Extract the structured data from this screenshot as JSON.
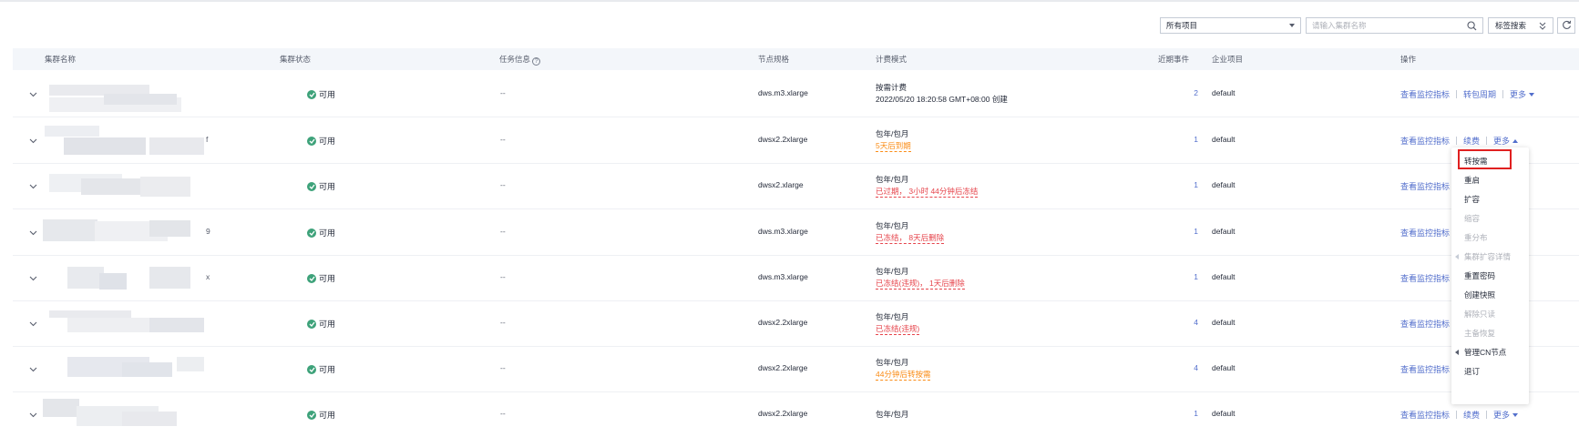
{
  "toolbar": {
    "project_select": "所有项目",
    "search_placeholder": "请输入集群名称",
    "tag_search_label": "标签搜索"
  },
  "table": {
    "headers": {
      "name": "集群名称",
      "status": "集群状态",
      "task": "任务信息",
      "spec": "节点规格",
      "billing": "计费模式",
      "events": "近期事件",
      "project": "企业项目",
      "ops": "操作"
    },
    "rows": [
      {
        "name_suffix": "",
        "status": "可用",
        "task": "--",
        "spec": "dws.m3.xlarge",
        "billing": "按需计费",
        "billing_sub": "2022/05/20 18:20:58 GMT+08:00 创建",
        "billing_sub_style": "plain",
        "events": "2",
        "project": "default",
        "op1": "查看监控指标",
        "op2": "转包周期",
        "more": "更多",
        "more_open": false
      },
      {
        "name_suffix": "f",
        "status": "可用",
        "task": "--",
        "spec": "dwsx2.2xlarge",
        "billing": "包年/包月",
        "billing_sub": "5天后到期",
        "billing_sub_style": "orange",
        "events": "1",
        "project": "default",
        "op1": "查看监控指标",
        "op2": "续费",
        "more": "更多",
        "more_open": true
      },
      {
        "name_suffix": "",
        "status": "可用",
        "task": "--",
        "spec": "dwsx2.xlarge",
        "billing": "包年/包月",
        "billing_sub": "已过期， 3小时 44分钟后冻结",
        "billing_sub_style": "red",
        "events": "1",
        "project": "default",
        "op1": "查看监控指标",
        "op2": "",
        "more": "",
        "more_open": false
      },
      {
        "name_suffix": "9",
        "status": "可用",
        "task": "--",
        "spec": "dws.m3.xlarge",
        "billing": "包年/包月",
        "billing_sub": "已冻结， 8天后删除",
        "billing_sub_style": "red",
        "events": "1",
        "project": "default",
        "op1": "查看监控指标",
        "op2": "",
        "more": "",
        "more_open": false
      },
      {
        "name_suffix": "x",
        "status": "可用",
        "task": "--",
        "spec": "dws.m3.xlarge",
        "billing": "包年/包月",
        "billing_sub": "已冻结(违规)， 1天后删除",
        "billing_sub_style": "red",
        "events": "1",
        "project": "default",
        "op1": "查看监控指标",
        "op2": "",
        "more": "",
        "more_open": false
      },
      {
        "name_suffix": "",
        "status": "可用",
        "task": "--",
        "spec": "dwsx2.2xlarge",
        "billing": "包年/包月",
        "billing_sub": "已冻结(违规)",
        "billing_sub_style": "red",
        "events": "4",
        "project": "default",
        "op1": "查看监控指标",
        "op2": "",
        "more": "",
        "more_open": false
      },
      {
        "name_suffix": "",
        "status": "可用",
        "task": "--",
        "spec": "dwsx2.2xlarge",
        "billing": "包年/包月",
        "billing_sub": "44分钟后转按需",
        "billing_sub_style": "orange",
        "events": "4",
        "project": "default",
        "op1": "查看监控指标",
        "op2": "",
        "more": "",
        "more_open": false
      },
      {
        "name_suffix": "",
        "status": "可用",
        "task": "--",
        "spec": "dwsx2.2xlarge",
        "billing": "包年/包月",
        "billing_sub": "",
        "billing_sub_style": "plain",
        "events": "1",
        "project": "default",
        "op1": "查看监控指标",
        "op2": "续费",
        "more": "更多",
        "more_open": false
      }
    ]
  },
  "more_menu": {
    "items": [
      {
        "label": "转按需",
        "disabled": false,
        "submenu": false
      },
      {
        "label": "重启",
        "disabled": false,
        "submenu": false
      },
      {
        "label": "扩容",
        "disabled": false,
        "submenu": false
      },
      {
        "label": "缩容",
        "disabled": true,
        "submenu": false
      },
      {
        "label": "重分布",
        "disabled": true,
        "submenu": false
      },
      {
        "label": "集群扩容详情",
        "disabled": true,
        "submenu": true
      },
      {
        "label": "重置密码",
        "disabled": false,
        "submenu": false
      },
      {
        "label": "创建快照",
        "disabled": false,
        "submenu": false
      },
      {
        "label": "解除只读",
        "disabled": true,
        "submenu": false
      },
      {
        "label": "主备恢复",
        "disabled": true,
        "submenu": false
      },
      {
        "label": "管理CN节点",
        "disabled": false,
        "submenu": true
      },
      {
        "label": "退订",
        "disabled": false,
        "submenu": false
      }
    ]
  },
  "colors": {
    "link": "#526ecc",
    "status_ok": "#3ea27a",
    "warn": "#fa8c16",
    "danger": "#e6454c",
    "highlight_box": "#e02020"
  }
}
